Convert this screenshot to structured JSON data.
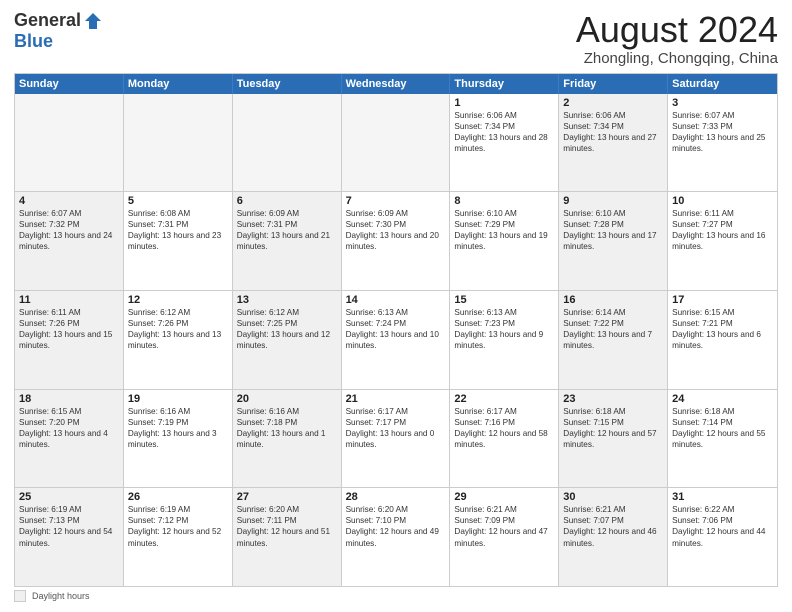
{
  "header": {
    "logo_general": "General",
    "logo_blue": "Blue",
    "month_title": "August 2024",
    "location": "Zhongling, Chongqing, China"
  },
  "days_of_week": [
    "Sunday",
    "Monday",
    "Tuesday",
    "Wednesday",
    "Thursday",
    "Friday",
    "Saturday"
  ],
  "weeks": [
    [
      {
        "day": "",
        "text": "",
        "shaded": false,
        "empty": true
      },
      {
        "day": "",
        "text": "",
        "shaded": false,
        "empty": true
      },
      {
        "day": "",
        "text": "",
        "shaded": false,
        "empty": true
      },
      {
        "day": "",
        "text": "",
        "shaded": false,
        "empty": true
      },
      {
        "day": "1",
        "text": "Sunrise: 6:06 AM\nSunset: 7:34 PM\nDaylight: 13 hours and 28 minutes.",
        "shaded": false,
        "empty": false
      },
      {
        "day": "2",
        "text": "Sunrise: 6:06 AM\nSunset: 7:34 PM\nDaylight: 13 hours and 27 minutes.",
        "shaded": true,
        "empty": false
      },
      {
        "day": "3",
        "text": "Sunrise: 6:07 AM\nSunset: 7:33 PM\nDaylight: 13 hours and 25 minutes.",
        "shaded": false,
        "empty": false
      }
    ],
    [
      {
        "day": "4",
        "text": "Sunrise: 6:07 AM\nSunset: 7:32 PM\nDaylight: 13 hours and 24 minutes.",
        "shaded": true,
        "empty": false
      },
      {
        "day": "5",
        "text": "Sunrise: 6:08 AM\nSunset: 7:31 PM\nDaylight: 13 hours and 23 minutes.",
        "shaded": false,
        "empty": false
      },
      {
        "day": "6",
        "text": "Sunrise: 6:09 AM\nSunset: 7:31 PM\nDaylight: 13 hours and 21 minutes.",
        "shaded": true,
        "empty": false
      },
      {
        "day": "7",
        "text": "Sunrise: 6:09 AM\nSunset: 7:30 PM\nDaylight: 13 hours and 20 minutes.",
        "shaded": false,
        "empty": false
      },
      {
        "day": "8",
        "text": "Sunrise: 6:10 AM\nSunset: 7:29 PM\nDaylight: 13 hours and 19 minutes.",
        "shaded": false,
        "empty": false
      },
      {
        "day": "9",
        "text": "Sunrise: 6:10 AM\nSunset: 7:28 PM\nDaylight: 13 hours and 17 minutes.",
        "shaded": true,
        "empty": false
      },
      {
        "day": "10",
        "text": "Sunrise: 6:11 AM\nSunset: 7:27 PM\nDaylight: 13 hours and 16 minutes.",
        "shaded": false,
        "empty": false
      }
    ],
    [
      {
        "day": "11",
        "text": "Sunrise: 6:11 AM\nSunset: 7:26 PM\nDaylight: 13 hours and 15 minutes.",
        "shaded": true,
        "empty": false
      },
      {
        "day": "12",
        "text": "Sunrise: 6:12 AM\nSunset: 7:26 PM\nDaylight: 13 hours and 13 minutes.",
        "shaded": false,
        "empty": false
      },
      {
        "day": "13",
        "text": "Sunrise: 6:12 AM\nSunset: 7:25 PM\nDaylight: 13 hours and 12 minutes.",
        "shaded": true,
        "empty": false
      },
      {
        "day": "14",
        "text": "Sunrise: 6:13 AM\nSunset: 7:24 PM\nDaylight: 13 hours and 10 minutes.",
        "shaded": false,
        "empty": false
      },
      {
        "day": "15",
        "text": "Sunrise: 6:13 AM\nSunset: 7:23 PM\nDaylight: 13 hours and 9 minutes.",
        "shaded": false,
        "empty": false
      },
      {
        "day": "16",
        "text": "Sunrise: 6:14 AM\nSunset: 7:22 PM\nDaylight: 13 hours and 7 minutes.",
        "shaded": true,
        "empty": false
      },
      {
        "day": "17",
        "text": "Sunrise: 6:15 AM\nSunset: 7:21 PM\nDaylight: 13 hours and 6 minutes.",
        "shaded": false,
        "empty": false
      }
    ],
    [
      {
        "day": "18",
        "text": "Sunrise: 6:15 AM\nSunset: 7:20 PM\nDaylight: 13 hours and 4 minutes.",
        "shaded": true,
        "empty": false
      },
      {
        "day": "19",
        "text": "Sunrise: 6:16 AM\nSunset: 7:19 PM\nDaylight: 13 hours and 3 minutes.",
        "shaded": false,
        "empty": false
      },
      {
        "day": "20",
        "text": "Sunrise: 6:16 AM\nSunset: 7:18 PM\nDaylight: 13 hours and 1 minute.",
        "shaded": true,
        "empty": false
      },
      {
        "day": "21",
        "text": "Sunrise: 6:17 AM\nSunset: 7:17 PM\nDaylight: 13 hours and 0 minutes.",
        "shaded": false,
        "empty": false
      },
      {
        "day": "22",
        "text": "Sunrise: 6:17 AM\nSunset: 7:16 PM\nDaylight: 12 hours and 58 minutes.",
        "shaded": false,
        "empty": false
      },
      {
        "day": "23",
        "text": "Sunrise: 6:18 AM\nSunset: 7:15 PM\nDaylight: 12 hours and 57 minutes.",
        "shaded": true,
        "empty": false
      },
      {
        "day": "24",
        "text": "Sunrise: 6:18 AM\nSunset: 7:14 PM\nDaylight: 12 hours and 55 minutes.",
        "shaded": false,
        "empty": false
      }
    ],
    [
      {
        "day": "25",
        "text": "Sunrise: 6:19 AM\nSunset: 7:13 PM\nDaylight: 12 hours and 54 minutes.",
        "shaded": true,
        "empty": false
      },
      {
        "day": "26",
        "text": "Sunrise: 6:19 AM\nSunset: 7:12 PM\nDaylight: 12 hours and 52 minutes.",
        "shaded": false,
        "empty": false
      },
      {
        "day": "27",
        "text": "Sunrise: 6:20 AM\nSunset: 7:11 PM\nDaylight: 12 hours and 51 minutes.",
        "shaded": true,
        "empty": false
      },
      {
        "day": "28",
        "text": "Sunrise: 6:20 AM\nSunset: 7:10 PM\nDaylight: 12 hours and 49 minutes.",
        "shaded": false,
        "empty": false
      },
      {
        "day": "29",
        "text": "Sunrise: 6:21 AM\nSunset: 7:09 PM\nDaylight: 12 hours and 47 minutes.",
        "shaded": false,
        "empty": false
      },
      {
        "day": "30",
        "text": "Sunrise: 6:21 AM\nSunset: 7:07 PM\nDaylight: 12 hours and 46 minutes.",
        "shaded": true,
        "empty": false
      },
      {
        "day": "31",
        "text": "Sunrise: 6:22 AM\nSunset: 7:06 PM\nDaylight: 12 hours and 44 minutes.",
        "shaded": false,
        "empty": false
      }
    ]
  ],
  "footer": {
    "label": "Daylight hours"
  }
}
